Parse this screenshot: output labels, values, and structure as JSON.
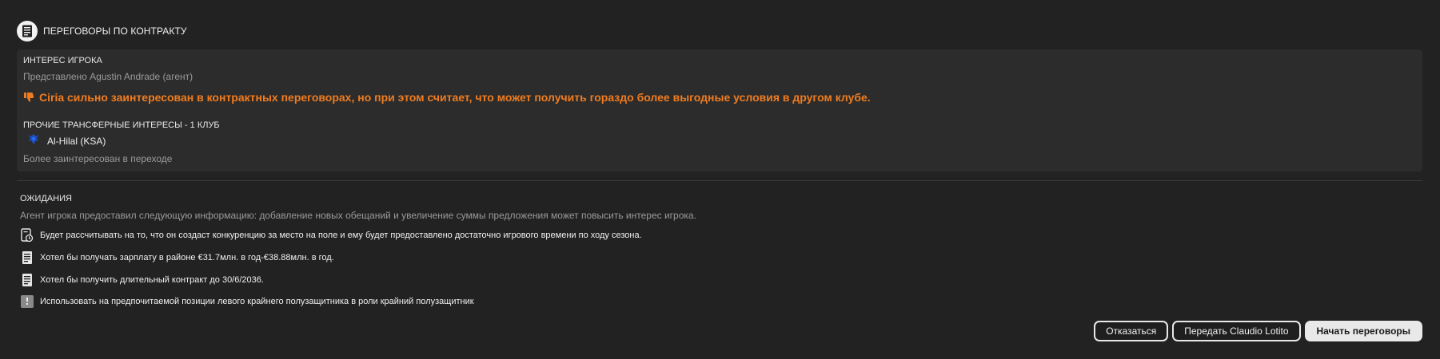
{
  "header": {
    "icon": "contract-document-icon",
    "title": "ПЕРЕГОВОРЫ ПО КОНТРАКТУ"
  },
  "player_interest": {
    "label": "ИНТЕРЕС ИГРОКА",
    "represented_by": "Представлено Agustin Andrade (агент)",
    "warning_icon": "thumbs-down-icon",
    "warning_text": "Ciria сильно заинтересован в контрактных переговорах, но при этом считает, что может получить гораздо более выгодные условия в другом клубе.",
    "warning_color": "#f07c1f",
    "other_label": "ПРОЧИЕ ТРАНСФЕРНЫЕ ИНТЕРЕСЫ - 1 КЛУБ",
    "club": {
      "icon": "al-hilal-crest-icon",
      "name": "Al-Hilal (KSA)"
    },
    "club_status": "Более заинтересован в переходе"
  },
  "expectations": {
    "title": "ОЖИДАНИЯ",
    "subtitle": "Агент игрока предоставил следующую информацию: добавление новых обещаний и увеличение суммы предложения может повысить интерес игрока.",
    "items": [
      {
        "icon": "playing-time-icon",
        "text": "Будет рассчитывать на то, что он создаст конкуренцию за место на поле и ему будет предоставлено достаточно игрового времени по ходу сезона."
      },
      {
        "icon": "contract-document-icon",
        "text": "Хотел бы получать зарплату в районе €31.7млн. в год-€38.88млн. в год."
      },
      {
        "icon": "contract-document-icon",
        "text": "Хотел бы получить длительный контракт до 30/6/2036."
      },
      {
        "icon": "position-icon",
        "text": "Использовать на предпочитаемой позиции левого крайнего полузащитника в роли крайний полузащитник"
      }
    ]
  },
  "actions": {
    "decline": "Отказаться",
    "delegate": "Передать Claudio Lotito",
    "start": "Начать переговоры"
  }
}
